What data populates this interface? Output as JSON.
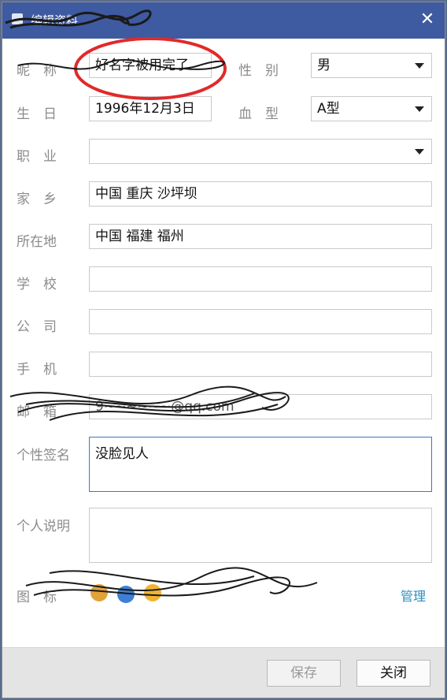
{
  "window": {
    "title": "编辑资料",
    "close_glyph": "✕"
  },
  "labels": {
    "nickname": "昵　称",
    "gender": "性　别",
    "birthday": "生　日",
    "blood": "血　型",
    "job": "职　业",
    "hometown": "家　乡",
    "location": "所在地",
    "school": "学　校",
    "company": "公　司",
    "phone": "手　机",
    "email": "邮　箱",
    "signature": "个性签名",
    "description": "个人说明",
    "icons": "图　标"
  },
  "fields": {
    "nickname": "好名字被用完了",
    "gender": "男",
    "birthday": "1996年12月3日",
    "blood": "A型",
    "job": "",
    "hometown": "中国  重庆  沙坪坝",
    "location": "中国  福建  福州",
    "school": "",
    "company": "",
    "phone": "",
    "email": "9~~~~~~@qq.com",
    "signature": "没脸见人",
    "description": ""
  },
  "links": {
    "manage": "管理"
  },
  "buttons": {
    "save": "保存",
    "close": "关闭"
  },
  "colors": {
    "titlebar": "#3e5aa0",
    "link": "#2a8fbd",
    "annotation_red": "#e02a2a"
  }
}
